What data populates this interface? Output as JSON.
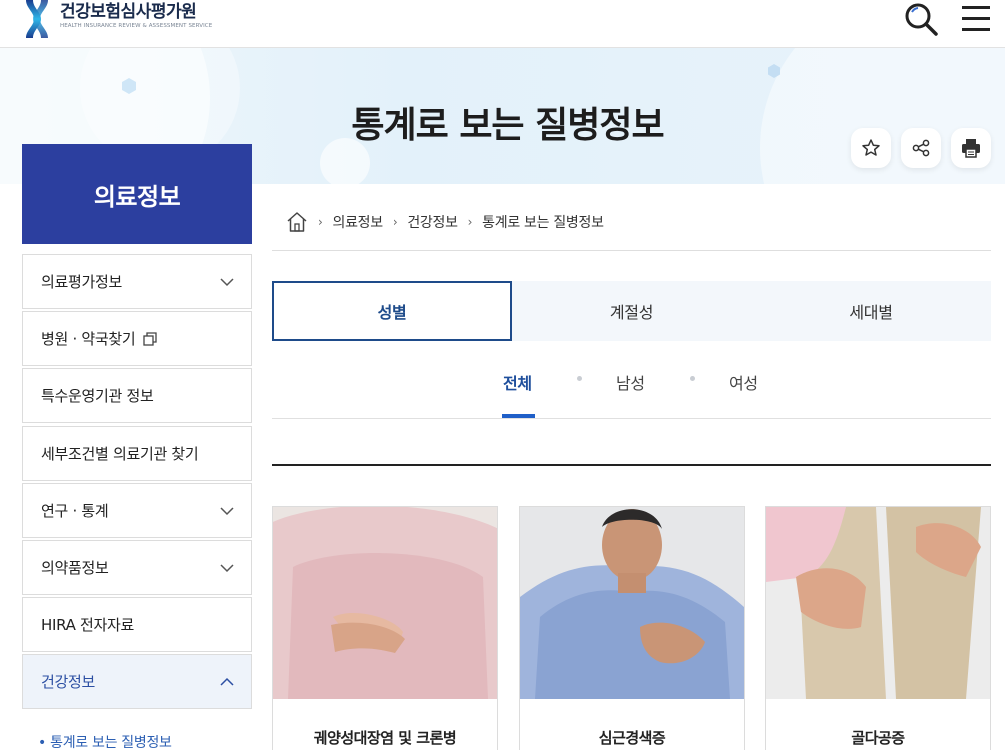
{
  "header": {
    "logo_name": "건강보험심사평가원",
    "logo_sub": "HEALTH INSURANCE REVIEW & ASSESSMENT SERVICE",
    "search_icon": "search-icon",
    "menu_icon": "hamburger-menu-icon"
  },
  "banner": {
    "title": "통계로 보는 질병정보",
    "tools": [
      "star-icon",
      "share-icon",
      "print-icon"
    ]
  },
  "sidebar": {
    "heading": "의료정보",
    "items": [
      {
        "label": "의료평가정보",
        "icon": "chevron-down-icon"
      },
      {
        "label": "병원 · 약국찾기",
        "icon": "external-link-icon"
      },
      {
        "label": "특수운영기관 정보"
      },
      {
        "label": "세부조건별 의료기관 찾기"
      },
      {
        "label": "연구 · 통계",
        "icon": "chevron-down-icon"
      },
      {
        "label": "의약품정보",
        "icon": "chevron-down-icon"
      },
      {
        "label": "HIRA 전자자료"
      },
      {
        "label": "건강정보",
        "icon": "chevron-up-icon",
        "active": true
      }
    ],
    "subitem": "• 통계로 보는 질병정보"
  },
  "breadcrumb": {
    "home_icon": "home-icon",
    "items": [
      "의료정보",
      "건강정보",
      "통계로 보는 질병정보"
    ]
  },
  "tabs": [
    {
      "label": "성별",
      "active": true
    },
    {
      "label": "계절성"
    },
    {
      "label": "세대별"
    }
  ],
  "subtabs": [
    {
      "label": "전체",
      "active": true
    },
    {
      "label": "남성"
    },
    {
      "label": "여성"
    }
  ],
  "cards": [
    {
      "title": "궤양성대장염 및 크론병"
    },
    {
      "title": "심근경색증"
    },
    {
      "title": "골다공증"
    }
  ],
  "colors": {
    "brand_navy": "#2c3f9f",
    "accent_blue": "#1f5fc8",
    "tab_border": "#1e4b8a"
  }
}
